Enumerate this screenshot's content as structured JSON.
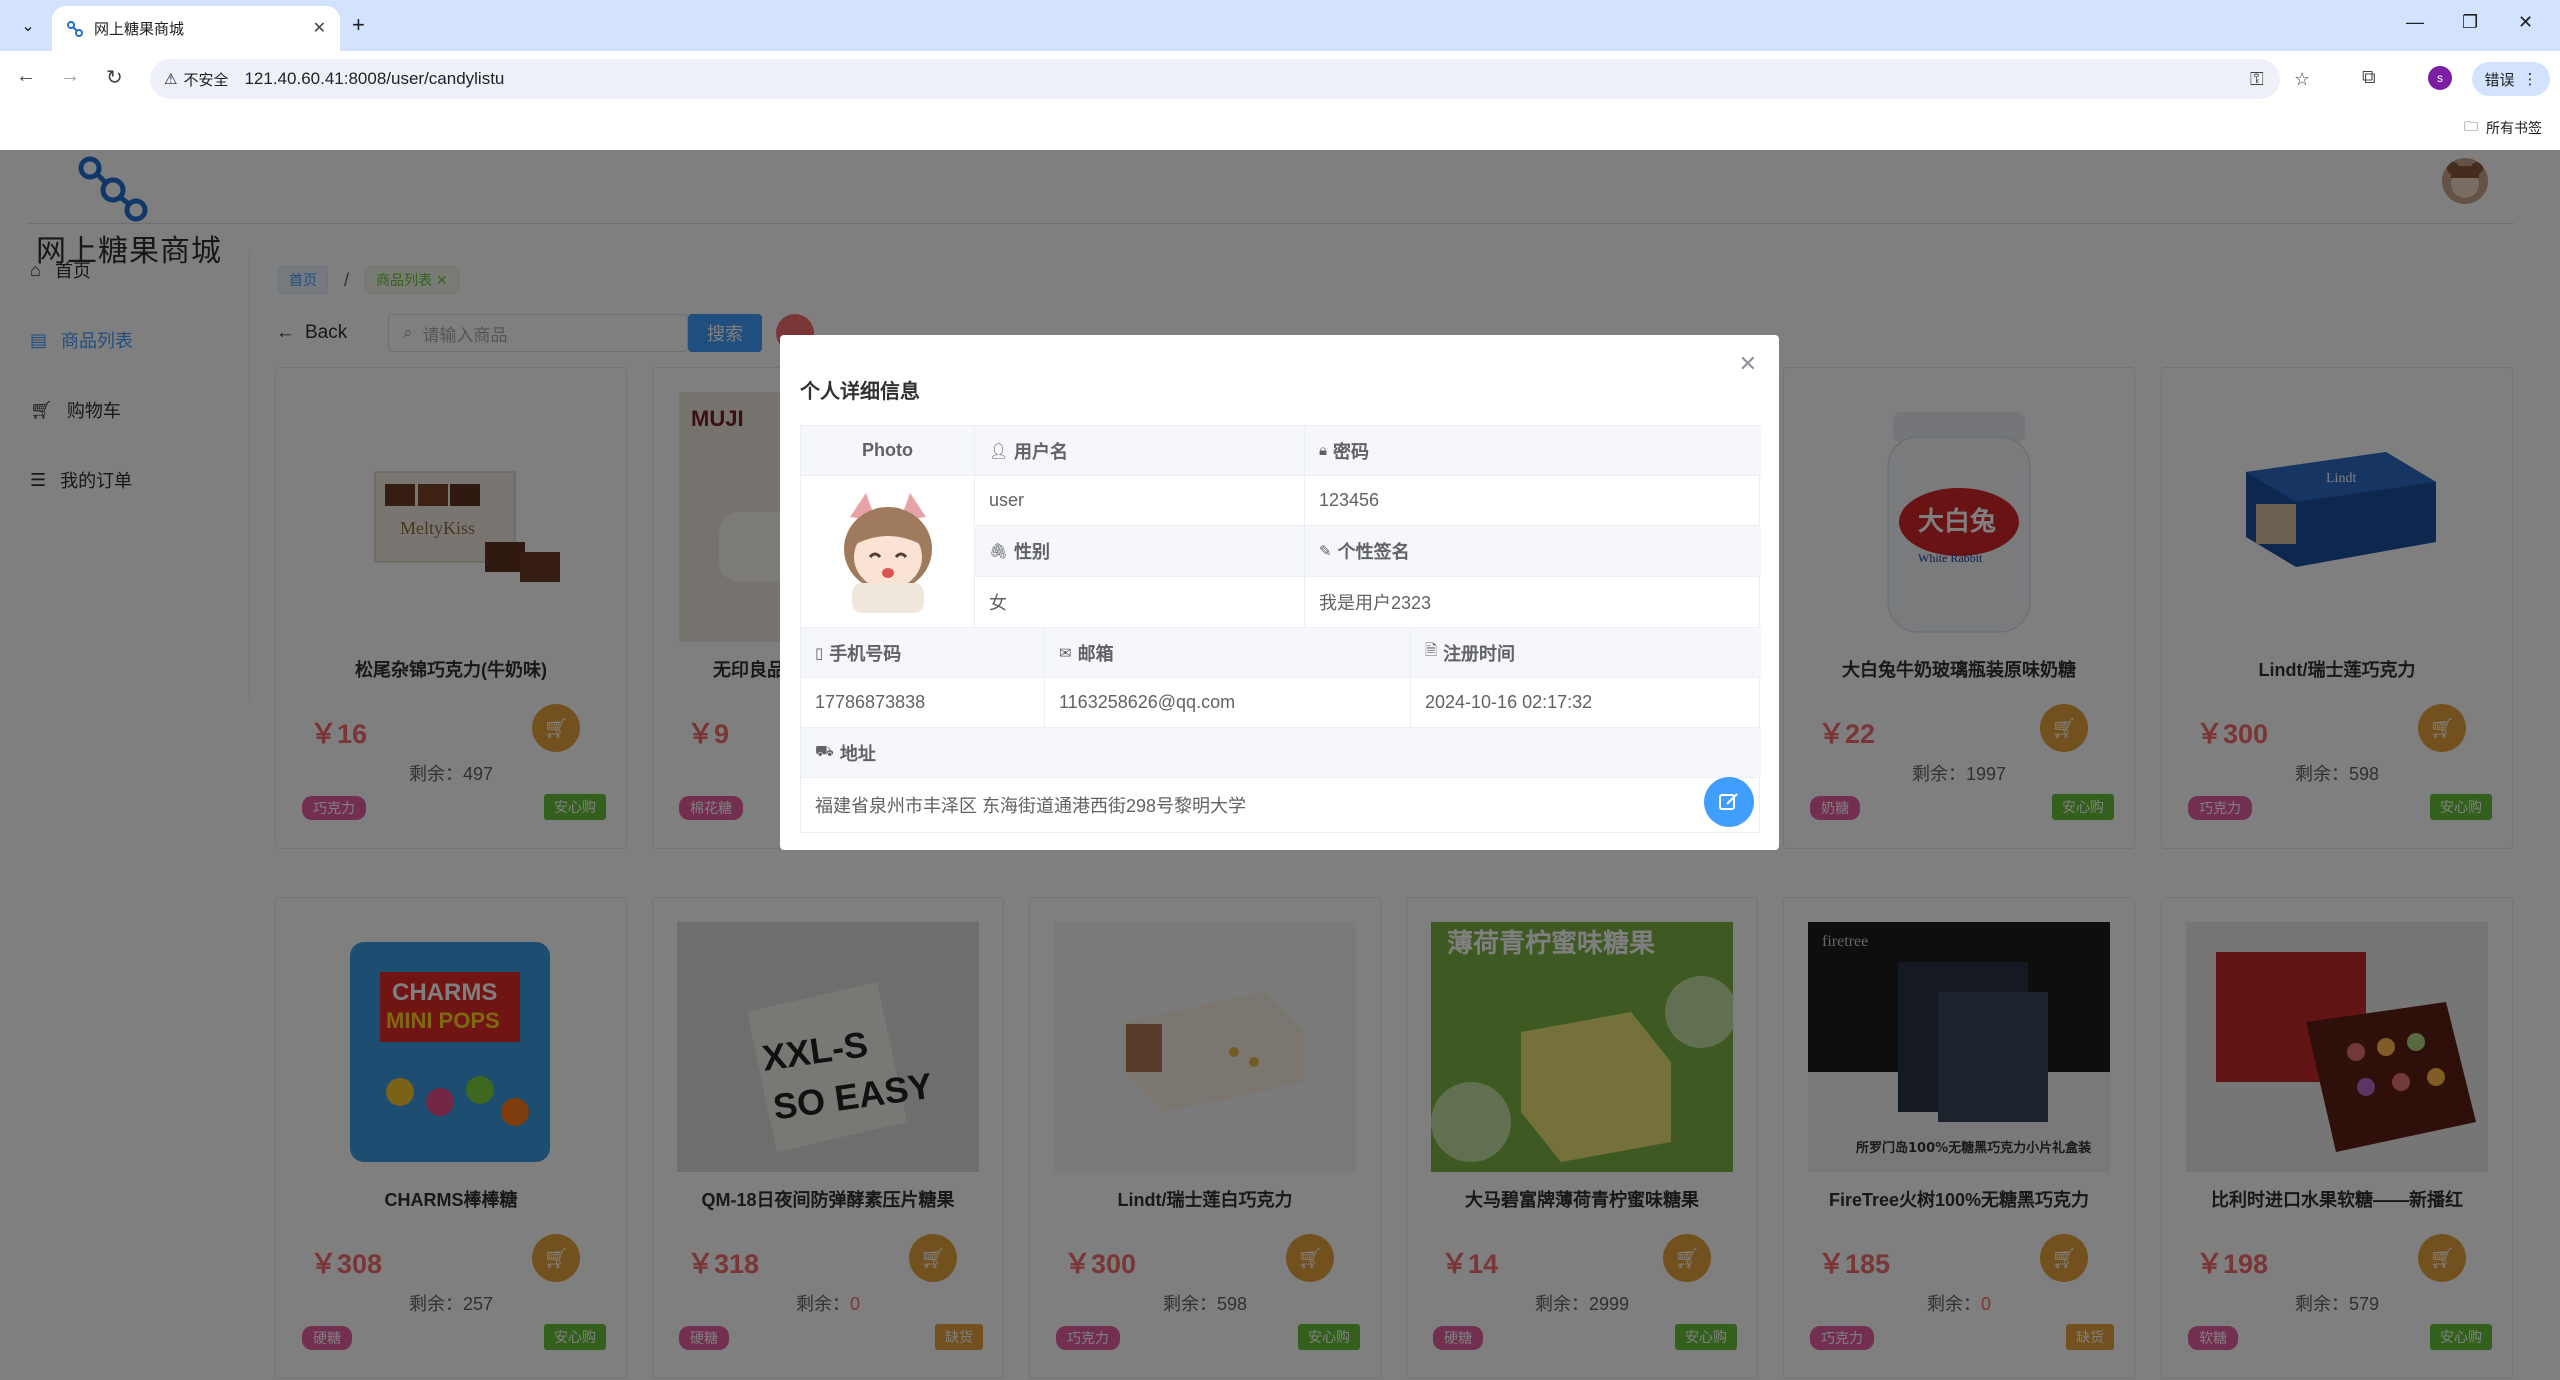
{
  "browser": {
    "tab_title": "网上糖果商城",
    "insecure_label": "不安全",
    "url": "121.40.60.41:8008/user/candylistu",
    "profile_initial": "s",
    "error_label": "错误",
    "bookmarks_all": "所有书签"
  },
  "site": {
    "name": "网上糖果商城"
  },
  "sidebar": {
    "items": [
      {
        "label": "首页",
        "icon": "home-icon"
      },
      {
        "label": "商品列表",
        "icon": "goods-icon"
      },
      {
        "label": "购物车",
        "icon": "cart-icon"
      },
      {
        "label": "我的订单",
        "icon": "order-icon"
      }
    ]
  },
  "breadcrumb": {
    "home": "首页",
    "current": "商品列表",
    "separator": "/"
  },
  "toolbar": {
    "back_label": "Back",
    "search_placeholder": "请输入商品",
    "search_label": "搜索"
  },
  "products_row1": [
    {
      "name": "松尾杂锦巧克力(牛奶味)",
      "price": "￥16",
      "stock_label": "剩余：",
      "stock": "497",
      "category": "巧克力",
      "badge": "安心购"
    },
    {
      "name": "无印良品",
      "price": "￥9",
      "category": "棉花糖"
    },
    {
      "name": "大白兔牛奶玻璃瓶装原味奶糖",
      "price": "￥22",
      "stock_label": "剩余：",
      "stock": "1997",
      "category": "奶糖",
      "badge": "安心购"
    },
    {
      "name": "Lindt/瑞士莲巧克力",
      "price": "￥300",
      "stock_label": "剩余：",
      "stock": "598",
      "category": "巧克力",
      "badge": "安心购"
    }
  ],
  "products_row2": [
    {
      "name": "CHARMS棒棒糖",
      "price": "￥308",
      "stock_label": "剩余：",
      "stock": "257",
      "category": "硬糖",
      "badge": "安心购"
    },
    {
      "name": "QM-18日夜间防弹酵素压片糖果",
      "price": "￥318",
      "stock_label": "剩余：",
      "stock": "0",
      "category": "硬糖",
      "badge": "缺货"
    },
    {
      "name": "Lindt/瑞士莲白巧克力",
      "price": "￥300",
      "stock_label": "剩余：",
      "stock": "598",
      "category": "巧克力",
      "badge": "安心购"
    },
    {
      "name": "大马碧富牌薄荷青柠蜜味糖果",
      "price": "￥14",
      "stock_label": "剩余：",
      "stock": "2999",
      "category": "硬糖",
      "badge": "安心购"
    },
    {
      "name": "FireTree火树100%无糖黑巧克力",
      "price": "￥185",
      "stock_label": "剩余：",
      "stock": "0",
      "category": "巧克力",
      "badge": "缺货"
    },
    {
      "name": "比利时进口水果软糖——新播红",
      "price": "￥198",
      "stock_label": "剩余：",
      "stock": "579",
      "category": "软糖",
      "badge": "安心购"
    }
  ],
  "dialog": {
    "title": "个人详细信息",
    "photo_label": "Photo",
    "username_label": "用户名",
    "username": "user",
    "password_label": "密码",
    "password": "123456",
    "gender_label": "性别",
    "gender": "女",
    "signature_label": "个性签名",
    "signature": "我是用户2323",
    "phone_label": "手机号码",
    "phone": "17786873838",
    "email_label": "邮箱",
    "email": "1163258626@qq.com",
    "register_label": "注册时间",
    "register_time": "2024-10-16 02:17:32",
    "address_label": "地址",
    "address": "福建省泉州市丰泽区 东海街道通港西街298号黎明大学"
  },
  "colors": {
    "accent": "#409eff",
    "price": "#f56c6c",
    "cart": "#e6a23c",
    "category": "#e75f9e",
    "badge_ok": "#67c23a",
    "badge_warn": "#e6a23c"
  }
}
